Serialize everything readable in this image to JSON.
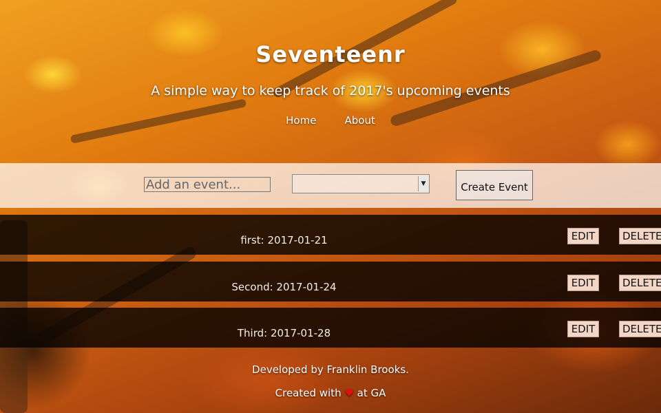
{
  "header": {
    "title": "Seventeenr",
    "subtitle": "A simple way to keep track of 2017's upcoming events",
    "nav": [
      {
        "label": "Home"
      },
      {
        "label": "About"
      }
    ]
  },
  "form": {
    "event_placeholder": "Add an event...",
    "date_value": "",
    "create_label": "Create Event"
  },
  "events": [
    {
      "text": "first: 2017-01-21",
      "edit_label": "EDIT",
      "delete_label": "DELETE"
    },
    {
      "text": "Second: 2017-01-24",
      "edit_label": "EDIT",
      "delete_label": "DELETE"
    },
    {
      "text": "Third: 2017-01-28",
      "edit_label": "EDIT",
      "delete_label": "DELETE"
    }
  ],
  "footer": {
    "developed": "Developed by Franklin Brooks.",
    "created_prefix": "Created with",
    "heart_glyph": "♥",
    "created_suffix": "at GA"
  },
  "colors": {
    "heart": "#e01010",
    "row_background": "#000000",
    "button_background": "#f3d6c6"
  }
}
